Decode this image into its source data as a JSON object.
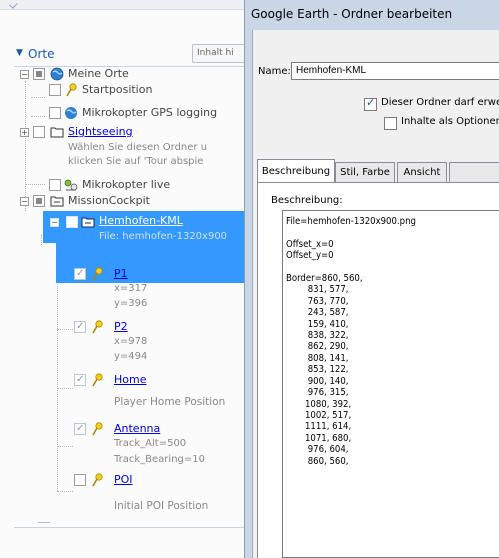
{
  "places_panel": {
    "title": "Orte",
    "content_button": "Inhalt hi",
    "items": [
      {
        "label": "Meine Orte"
      },
      {
        "label": "Startposition"
      },
      {
        "label": "Mikrokopter GPS logging"
      },
      {
        "label": "Sightseeing",
        "desc": [
          "Wählen Sie diesen Ordner u",
          "klicken Sie auf 'Tour abspie"
        ]
      },
      {
        "label": "Mikrokopter live"
      },
      {
        "label": "MissionCockpit"
      },
      {
        "label": "Hemhofen-KML",
        "desc": "File: hemhofen-1320x900"
      },
      {
        "label": "P1",
        "desc": [
          "x=317",
          "y=396"
        ]
      },
      {
        "label": "P2",
        "desc": [
          "x=978",
          "y=494"
        ]
      },
      {
        "label": "Home",
        "desc": "Player Home Position"
      },
      {
        "label": "Antenna",
        "desc": [
          "Track_Alt=500",
          "Track_Bearing=10"
        ]
      },
      {
        "label": "POI",
        "desc": "Initial POI Position"
      }
    ]
  },
  "dialog": {
    "title": "Google Earth - Ordner bearbeiten",
    "name_label": "Name:",
    "name_value": "Hemhofen-KML",
    "option_allow": "Dieser Ordner darf erwe",
    "option_allow_checked": true,
    "option_contents": "Inhalte als Optioner",
    "option_contents_checked": false,
    "tabs": [
      "Beschreibung",
      "Stil, Farbe",
      "Ansicht"
    ],
    "active_tab": "Beschreibung",
    "description_label": "Beschreibung:",
    "description_text": "File=hemhofen-1320x900.png\n\nOffset_x=0\nOffset_y=0\n\nBorder=860, 560,\n        831, 577,\n        763, 770,\n        243, 587,\n        159, 410,\n        838, 322,\n        862, 290,\n        808, 141,\n        853, 122,\n        900, 140,\n        976, 315,\n       1080, 392,\n       1002, 517,\n       1111, 614,\n       1071, 680,\n        976, 604,\n        860, 560,"
  },
  "colors": {
    "selection": "#3399ff",
    "link": "#0000dd",
    "dialog_bg": "#f0f0f0",
    "titlebar": "#c8d6e6",
    "pin_yellow": "#f2cf1f"
  },
  "icons": [
    "earth-icon",
    "pushpin-icon",
    "folder-icon",
    "live-device-icon",
    "kml-link-icon"
  ]
}
